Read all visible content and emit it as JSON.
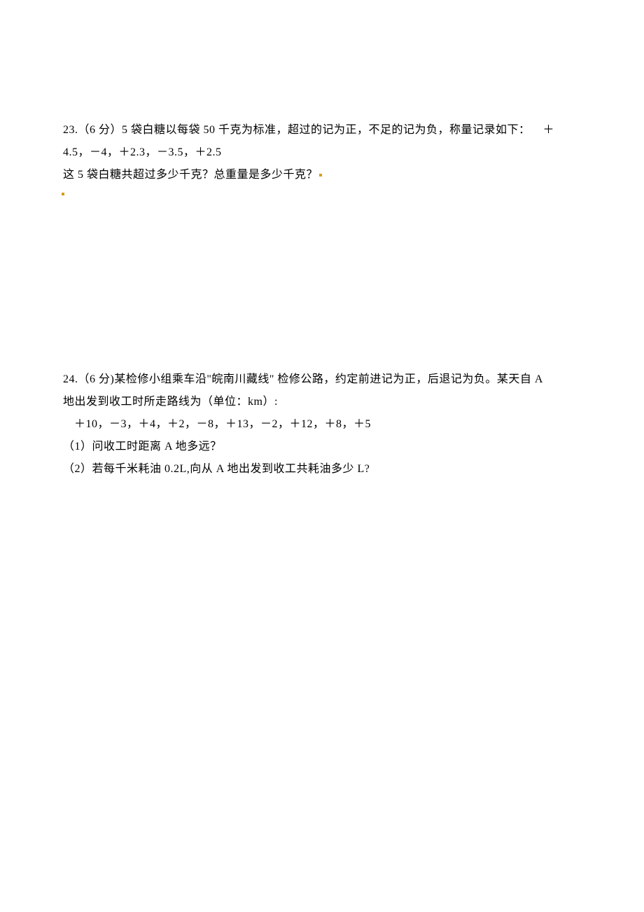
{
  "problem23": {
    "number": "23.",
    "points": "（6 分）",
    "line1_part1": "5 袋白糖以每袋 50 千克为标准，超过的记为正，不足的记为负，称量记录如下：",
    "line1_part2": "＋",
    "line2": "4.5，－4，＋2.3，－3.5，＋2.5",
    "line3": "这 5 袋白糖共超过多少千克？总重量是多少千克？"
  },
  "problem24": {
    "number": "24.",
    "points": "（6 分)",
    "line1": "某检修小组乘车沿\"皖南川藏线\" 检修公路，约定前进记为正，后退记为负。某天自 A",
    "line2": "地出发到收工时所走路线为（单位：km）:",
    "data": "＋10，－3，＋4，＋2，－8，＋13，－2，＋12，＋8，＋5",
    "sub1": "（1）问收工时距离 A 地多远？",
    "sub2": "（2）若每千米耗油 0.2L,向从 A 地出发到收工共耗油多少 L?"
  }
}
